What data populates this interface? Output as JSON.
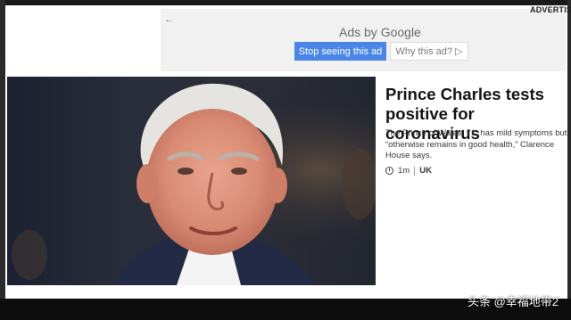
{
  "ad": {
    "label": "ADVERTIS",
    "back_glyph": "←",
    "ads_by_google": "Ads by Google",
    "stop_button": "Stop seeing this ad",
    "why_button": "Why this ad? ▷"
  },
  "article": {
    "headline": "Prince Charles tests positive for coronavirus",
    "summary": "The Prince of Wales, 71, has mild symptoms but “otherwise remains in good health,” Clarence House says.",
    "time": "1m",
    "tag": "UK"
  },
  "watermark": "头条 @幸福地带2",
  "colors": {
    "stop_button_bg": "#4a86e8",
    "ad_panel_bg": "#f1f1f1"
  },
  "icons": [
    "back-arrow-icon",
    "clock-icon",
    "adchoices-icon"
  ]
}
